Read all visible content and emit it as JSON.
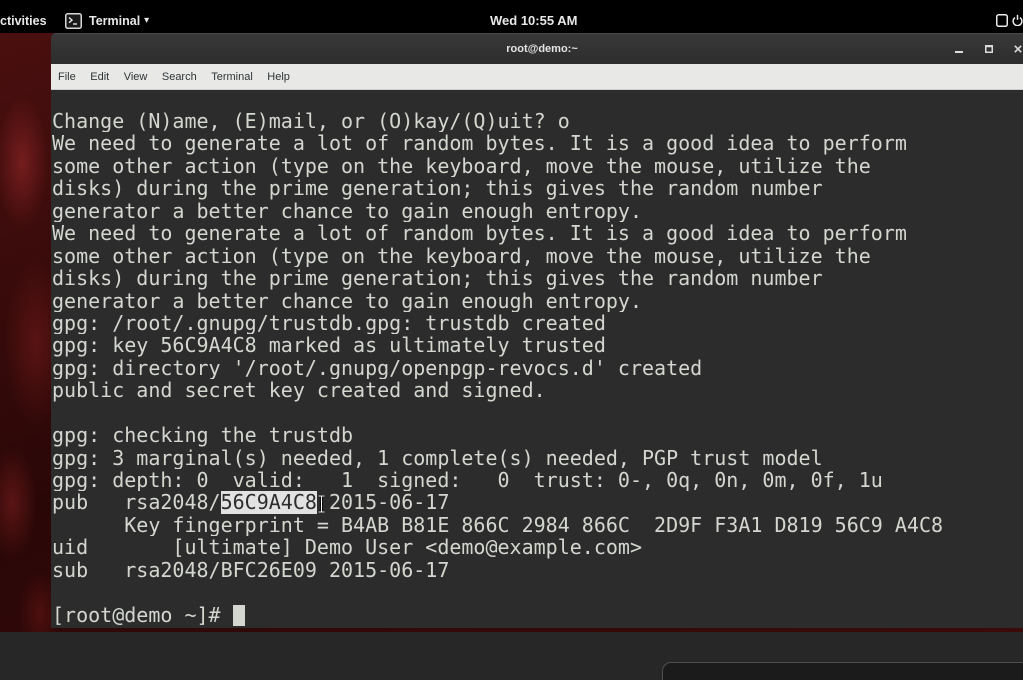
{
  "top_bar": {
    "activities_label": "ctivities",
    "app_menu": {
      "icon": "terminal-icon",
      "label": "Terminal",
      "arrow": "▾"
    },
    "clock": "Wed 10:55 AM",
    "status_icons": [
      "window-icon",
      "power-icon"
    ]
  },
  "window": {
    "title": "root@demo:~",
    "controls": [
      "minimize-icon",
      "maximize-icon",
      "close-icon"
    ],
    "menu": [
      "File",
      "Edit",
      "View",
      "Search",
      "Terminal",
      "Help"
    ]
  },
  "terminal": {
    "lines": [
      "Change (N)ame, (E)mail, or (O)kay/(Q)uit? o",
      "We need to generate a lot of random bytes. It is a good idea to perform",
      "some other action (type on the keyboard, move the mouse, utilize the",
      "disks) during the prime generation; this gives the random number",
      "generator a better chance to gain enough entropy.",
      "We need to generate a lot of random bytes. It is a good idea to perform",
      "some other action (type on the keyboard, move the mouse, utilize the",
      "disks) during the prime generation; this gives the random number",
      "generator a better chance to gain enough entropy.",
      "gpg: /root/.gnupg/trustdb.gpg: trustdb created",
      "gpg: key 56C9A4C8 marked as ultimately trusted",
      "gpg: directory '/root/.gnupg/openpgp-revocs.d' created",
      "public and secret key created and signed.",
      "",
      "gpg: checking the trustdb",
      "gpg: 3 marginal(s) needed, 1 complete(s) needed, PGP trust model",
      "gpg: depth: 0  valid:   1  signed:   0  trust: 0-, 0q, 0n, 0m, 0f, 1u",
      {
        "before": "pub   rsa2048/",
        "selected": "56C9A4C8",
        "after": " 2015-06-17"
      },
      "      Key fingerprint = B4AB B81E 866C 2984 866C  2D9F F3A1 D819 56C9 A4C8",
      "uid       [ultimate] Demo User <demo@example.com>",
      "sub   rsa2048/BFC26E09 2015-06-17",
      ""
    ],
    "prompt": "[root@demo ~]# "
  },
  "colors": {
    "terminal_background": "#2c2c2c",
    "terminal_text": "#d3d7cf",
    "selection_background": "#e2e2e2",
    "selection_text": "#2c2c2c",
    "menubar_background": "#e8e8e7",
    "topbar_background": "#000000"
  }
}
